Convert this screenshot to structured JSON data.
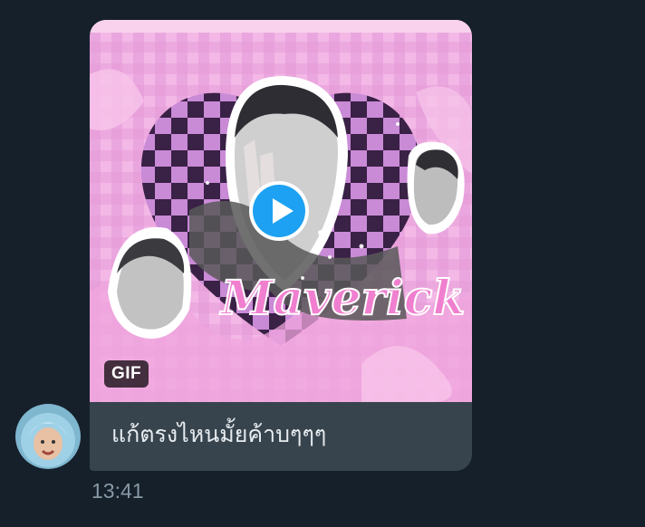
{
  "message": {
    "media": {
      "type_badge": "GIF",
      "overlay_text": "Maverick"
    },
    "text": "แก้ตรงไหนมั้ยค้าบๆๆๆ",
    "timestamp": "13:41"
  },
  "colors": {
    "background": "#15202b",
    "bubble": "#38444d",
    "play_button": "#1da1f2",
    "timestamp": "#8899a6"
  },
  "icons": {
    "play": "play-icon"
  }
}
